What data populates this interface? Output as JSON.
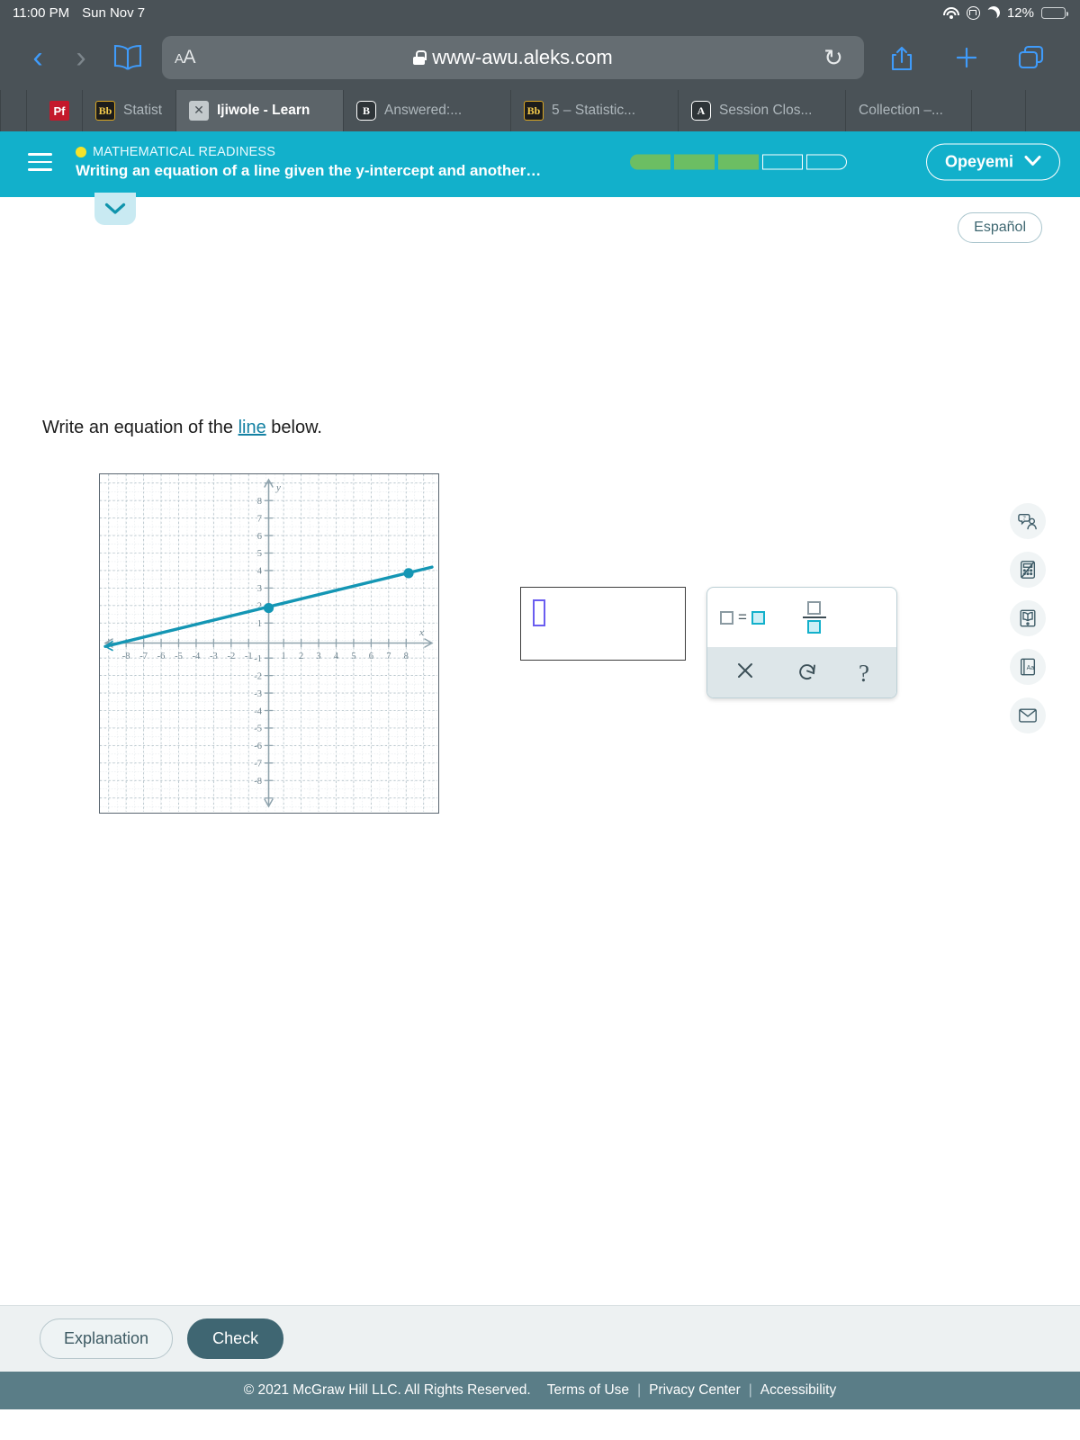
{
  "status_bar": {
    "time": "11:00 PM",
    "date": "Sun Nov 7",
    "battery_percent": "12%",
    "icons": [
      "wifi-icon",
      "rotation-lock-icon",
      "do-not-disturb-moon-icon",
      "battery-icon"
    ]
  },
  "browser": {
    "back_icon": "‹",
    "forward_icon": "›",
    "sidebar_icon": "book-icon",
    "text_size_label_small": "A",
    "text_size_label_large": "A",
    "url": "www-awu.aleks.com",
    "reload_icon": "↻",
    "share_icon": "share-icon",
    "new_tab_icon": "+",
    "tabs_overview_icon": "tabs-icon",
    "tabs": [
      {
        "favicon": "pf",
        "label": "",
        "active": false
      },
      {
        "favicon": "bb",
        "label": "Statist",
        "active": false
      },
      {
        "favicon": "x",
        "label": "Ijiwole - Learn",
        "active": true
      },
      {
        "favicon": "b",
        "label": "Answered:...",
        "active": false
      },
      {
        "favicon": "bb",
        "label": "5 – Statistic...",
        "active": false
      },
      {
        "favicon": "a",
        "label": "Session Clos...",
        "active": false
      },
      {
        "favicon": "none",
        "label": "Collection –...",
        "active": false
      },
      {
        "favicon": "none",
        "label": "",
        "active": false
      },
      {
        "favicon": "none",
        "label": "",
        "active": false
      }
    ]
  },
  "aleks_header": {
    "menu_icon": "hamburger-icon",
    "topic_label": "MATHEMATICAL READINESS",
    "objective": "Writing an equation of a line given the y-intercept and another…",
    "progress": {
      "total": 5,
      "filled": 3,
      "fill_color": "#6cbe63"
    },
    "user_name": "Opeyemi",
    "user_chevron": "⌵",
    "background_color": "#12b0cb"
  },
  "content": {
    "collapse_chevron": "⌵",
    "espanol_label": "Español",
    "question_prefix": "Write an equation of the ",
    "question_link": "line",
    "question_suffix": " below."
  },
  "chart_data": {
    "type": "line",
    "title": "",
    "xlabel": "x",
    "ylabel": "y",
    "xlim": [
      -9,
      9
    ],
    "ylim": [
      -9,
      9
    ],
    "xticks": [
      -8,
      -7,
      -6,
      -5,
      -4,
      -3,
      -2,
      -1,
      1,
      2,
      3,
      4,
      5,
      6,
      7,
      8
    ],
    "yticks": [
      -8,
      -7,
      -6,
      -5,
      -4,
      -3,
      -2,
      -1,
      1,
      2,
      3,
      4,
      5,
      6,
      7,
      8
    ],
    "grid": true,
    "series": [
      {
        "name": "line",
        "color": "#1496b4",
        "slope": 0.25,
        "intercept": 2,
        "points": [
          {
            "x": 0,
            "y": 2,
            "marked": true
          },
          {
            "x": 8,
            "y": 4,
            "marked": true
          }
        ]
      }
    ],
    "legend": "none"
  },
  "answer": {
    "value": "",
    "placeholder_box": "empty-answer-slot"
  },
  "math_palette": {
    "buttons": [
      {
        "name": "equation-template",
        "glyph": "□=□"
      },
      {
        "name": "fraction-template",
        "glyph": "□/□"
      },
      {
        "name": "clear",
        "glyph": "×"
      },
      {
        "name": "undo",
        "glyph": "↺"
      },
      {
        "name": "help",
        "glyph": "?"
      }
    ]
  },
  "tools_rail": [
    {
      "name": "ask-question-icon"
    },
    {
      "name": "calculator-disabled-icon"
    },
    {
      "name": "ebook-icon"
    },
    {
      "name": "dictionary-icon"
    },
    {
      "name": "message-icon"
    }
  ],
  "footer": {
    "explanation_label": "Explanation",
    "check_label": "Check",
    "copyright": "© 2021 McGraw Hill LLC. All Rights Reserved.",
    "links": [
      "Terms of Use",
      "Privacy Center",
      "Accessibility"
    ],
    "divider": "|"
  }
}
